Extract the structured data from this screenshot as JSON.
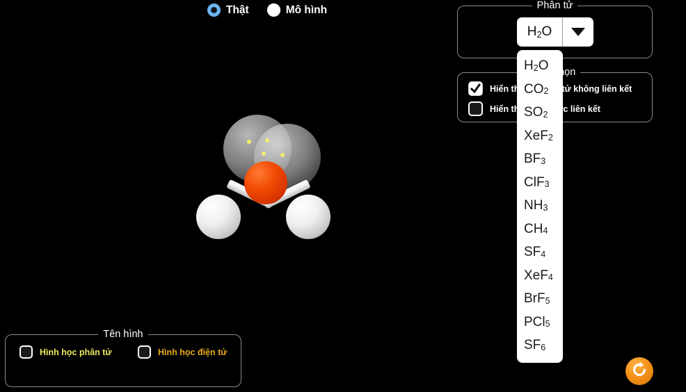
{
  "view_modes": {
    "options": [
      {
        "label": "Thật",
        "selected": true
      },
      {
        "label": "Mô hình",
        "selected": false
      }
    ]
  },
  "molecule_panel": {
    "title": "Phân tử",
    "selected_value": "H2O",
    "selected_base": "H",
    "selected_sub": "2",
    "selected_tail": "O",
    "arrow_icon": "chevron-down-icon",
    "options": [
      {
        "base": "H",
        "sub": "2",
        "tail": "O",
        "text": "H2O"
      },
      {
        "base": "CO",
        "sub": "2",
        "tail": "",
        "text": "CO2"
      },
      {
        "base": "SO",
        "sub": "2",
        "tail": "",
        "text": "SO2"
      },
      {
        "base": "XeF",
        "sub": "2",
        "tail": "",
        "text": "XeF2"
      },
      {
        "base": "BF",
        "sub": "3",
        "tail": "",
        "text": "BF3"
      },
      {
        "base": "ClF",
        "sub": "3",
        "tail": "",
        "text": "ClF3"
      },
      {
        "base": "NH",
        "sub": "3",
        "tail": "",
        "text": "NH3"
      },
      {
        "base": "CH",
        "sub": "4",
        "tail": "",
        "text": "CH4"
      },
      {
        "base": "SF",
        "sub": "4",
        "tail": "",
        "text": "SF4"
      },
      {
        "base": "XeF",
        "sub": "4",
        "tail": "",
        "text": "XeF4"
      },
      {
        "base": "BrF",
        "sub": "5",
        "tail": "",
        "text": "BrF5"
      },
      {
        "base": "PCl",
        "sub": "5",
        "tail": "",
        "text": "PCl5"
      },
      {
        "base": "SF",
        "sub": "6",
        "tail": "",
        "text": "SF6"
      }
    ]
  },
  "options_panel": {
    "title": "Tùy chọn",
    "checkboxes": [
      {
        "label": "Hiển thị cặp điện tử không liên kết",
        "checked": true
      },
      {
        "label": "Hiển thị lưỡng cực liên kết",
        "checked": false
      }
    ]
  },
  "name_panel": {
    "title": "Tên hình",
    "checkboxes": [
      {
        "label": "Hình học phân tử",
        "checked": false,
        "color": "#e8e85c"
      },
      {
        "label": "Hình học điện tử",
        "checked": false,
        "color": "#e8a81c"
      }
    ]
  },
  "reset": {
    "icon": "refresh-icon",
    "color": "#f39117"
  },
  "molecule_view": {
    "name": "water-molecule",
    "central_atom": {
      "element": "O",
      "color": "#e63a00"
    },
    "terminal_atoms": [
      {
        "element": "H",
        "color": "#f2f2f2"
      },
      {
        "element": "H",
        "color": "#f2f2f2"
      }
    ],
    "lone_pairs": 2,
    "electron_dot_color": "#f2f06a",
    "background": "#000000"
  }
}
